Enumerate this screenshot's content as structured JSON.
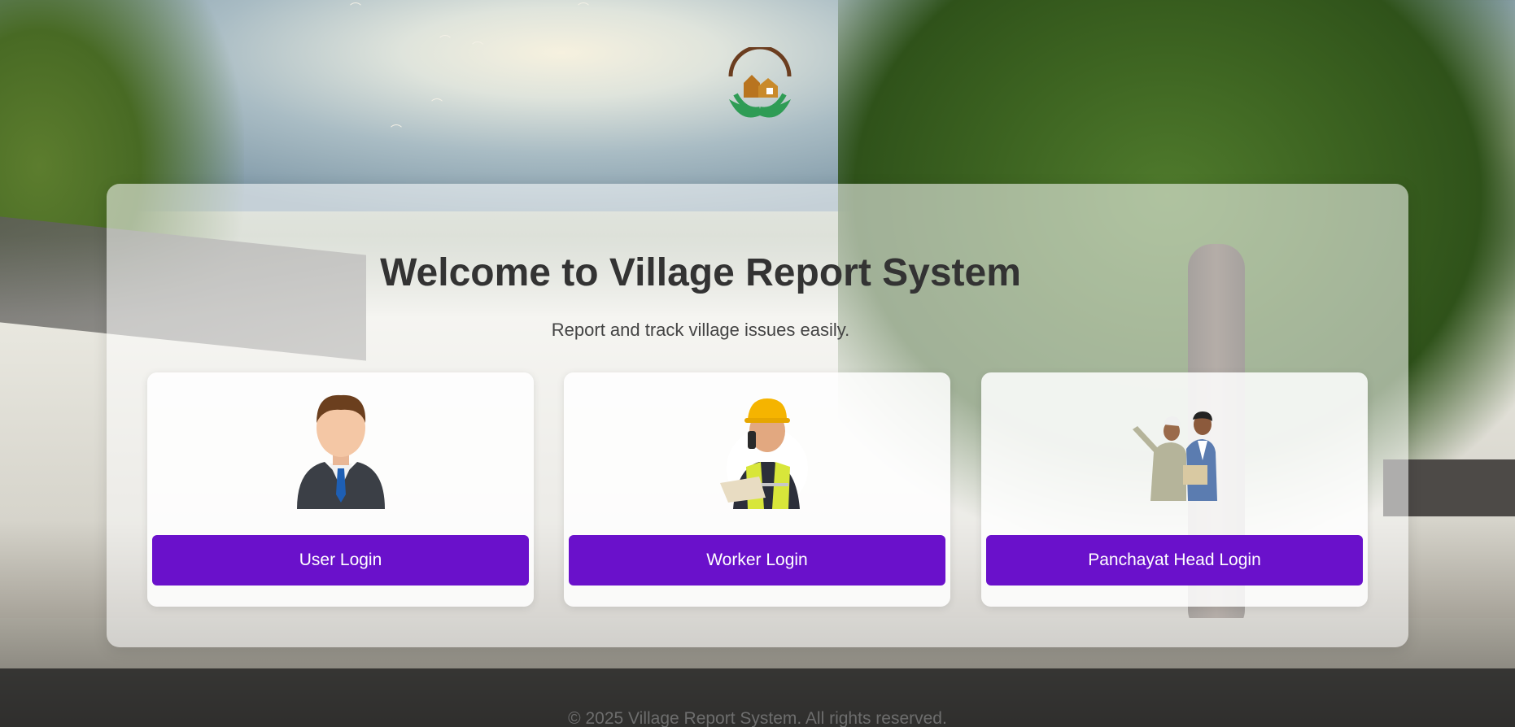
{
  "logo": {
    "icon": "village-hands-logo-icon"
  },
  "hero": {
    "title": "Welcome to Village Report System",
    "subtitle": "Report and track village issues easily."
  },
  "cards": [
    {
      "image": "businessman-avatar-icon",
      "button_label": "User Login"
    },
    {
      "image": "construction-worker-icon",
      "button_label": "Worker Login"
    },
    {
      "image": "panchayat-head-icon",
      "button_label": "Panchayat Head Login"
    }
  ],
  "footer": {
    "copyright": "© 2025 Village Report System. All rights reserved."
  },
  "colors": {
    "button": "#6a11cb",
    "title": "#333333"
  }
}
